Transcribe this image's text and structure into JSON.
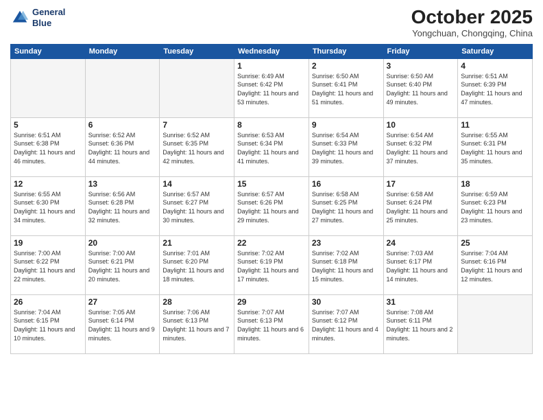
{
  "logo": {
    "line1": "General",
    "line2": "Blue"
  },
  "title": "October 2025",
  "location": "Yongchuan, Chongqing, China",
  "weekdays": [
    "Sunday",
    "Monday",
    "Tuesday",
    "Wednesday",
    "Thursday",
    "Friday",
    "Saturday"
  ],
  "weeks": [
    [
      {
        "day": "",
        "sunrise": "",
        "sunset": "",
        "daylight": ""
      },
      {
        "day": "",
        "sunrise": "",
        "sunset": "",
        "daylight": ""
      },
      {
        "day": "",
        "sunrise": "",
        "sunset": "",
        "daylight": ""
      },
      {
        "day": "1",
        "sunrise": "Sunrise: 6:49 AM",
        "sunset": "Sunset: 6:42 PM",
        "daylight": "Daylight: 11 hours and 53 minutes."
      },
      {
        "day": "2",
        "sunrise": "Sunrise: 6:50 AM",
        "sunset": "Sunset: 6:41 PM",
        "daylight": "Daylight: 11 hours and 51 minutes."
      },
      {
        "day": "3",
        "sunrise": "Sunrise: 6:50 AM",
        "sunset": "Sunset: 6:40 PM",
        "daylight": "Daylight: 11 hours and 49 minutes."
      },
      {
        "day": "4",
        "sunrise": "Sunrise: 6:51 AM",
        "sunset": "Sunset: 6:39 PM",
        "daylight": "Daylight: 11 hours and 47 minutes."
      }
    ],
    [
      {
        "day": "5",
        "sunrise": "Sunrise: 6:51 AM",
        "sunset": "Sunset: 6:38 PM",
        "daylight": "Daylight: 11 hours and 46 minutes."
      },
      {
        "day": "6",
        "sunrise": "Sunrise: 6:52 AM",
        "sunset": "Sunset: 6:36 PM",
        "daylight": "Daylight: 11 hours and 44 minutes."
      },
      {
        "day": "7",
        "sunrise": "Sunrise: 6:52 AM",
        "sunset": "Sunset: 6:35 PM",
        "daylight": "Daylight: 11 hours and 42 minutes."
      },
      {
        "day": "8",
        "sunrise": "Sunrise: 6:53 AM",
        "sunset": "Sunset: 6:34 PM",
        "daylight": "Daylight: 11 hours and 41 minutes."
      },
      {
        "day": "9",
        "sunrise": "Sunrise: 6:54 AM",
        "sunset": "Sunset: 6:33 PM",
        "daylight": "Daylight: 11 hours and 39 minutes."
      },
      {
        "day": "10",
        "sunrise": "Sunrise: 6:54 AM",
        "sunset": "Sunset: 6:32 PM",
        "daylight": "Daylight: 11 hours and 37 minutes."
      },
      {
        "day": "11",
        "sunrise": "Sunrise: 6:55 AM",
        "sunset": "Sunset: 6:31 PM",
        "daylight": "Daylight: 11 hours and 35 minutes."
      }
    ],
    [
      {
        "day": "12",
        "sunrise": "Sunrise: 6:55 AM",
        "sunset": "Sunset: 6:30 PM",
        "daylight": "Daylight: 11 hours and 34 minutes."
      },
      {
        "day": "13",
        "sunrise": "Sunrise: 6:56 AM",
        "sunset": "Sunset: 6:28 PM",
        "daylight": "Daylight: 11 hours and 32 minutes."
      },
      {
        "day": "14",
        "sunrise": "Sunrise: 6:57 AM",
        "sunset": "Sunset: 6:27 PM",
        "daylight": "Daylight: 11 hours and 30 minutes."
      },
      {
        "day": "15",
        "sunrise": "Sunrise: 6:57 AM",
        "sunset": "Sunset: 6:26 PM",
        "daylight": "Daylight: 11 hours and 29 minutes."
      },
      {
        "day": "16",
        "sunrise": "Sunrise: 6:58 AM",
        "sunset": "Sunset: 6:25 PM",
        "daylight": "Daylight: 11 hours and 27 minutes."
      },
      {
        "day": "17",
        "sunrise": "Sunrise: 6:58 AM",
        "sunset": "Sunset: 6:24 PM",
        "daylight": "Daylight: 11 hours and 25 minutes."
      },
      {
        "day": "18",
        "sunrise": "Sunrise: 6:59 AM",
        "sunset": "Sunset: 6:23 PM",
        "daylight": "Daylight: 11 hours and 23 minutes."
      }
    ],
    [
      {
        "day": "19",
        "sunrise": "Sunrise: 7:00 AM",
        "sunset": "Sunset: 6:22 PM",
        "daylight": "Daylight: 11 hours and 22 minutes."
      },
      {
        "day": "20",
        "sunrise": "Sunrise: 7:00 AM",
        "sunset": "Sunset: 6:21 PM",
        "daylight": "Daylight: 11 hours and 20 minutes."
      },
      {
        "day": "21",
        "sunrise": "Sunrise: 7:01 AM",
        "sunset": "Sunset: 6:20 PM",
        "daylight": "Daylight: 11 hours and 18 minutes."
      },
      {
        "day": "22",
        "sunrise": "Sunrise: 7:02 AM",
        "sunset": "Sunset: 6:19 PM",
        "daylight": "Daylight: 11 hours and 17 minutes."
      },
      {
        "day": "23",
        "sunrise": "Sunrise: 7:02 AM",
        "sunset": "Sunset: 6:18 PM",
        "daylight": "Daylight: 11 hours and 15 minutes."
      },
      {
        "day": "24",
        "sunrise": "Sunrise: 7:03 AM",
        "sunset": "Sunset: 6:17 PM",
        "daylight": "Daylight: 11 hours and 14 minutes."
      },
      {
        "day": "25",
        "sunrise": "Sunrise: 7:04 AM",
        "sunset": "Sunset: 6:16 PM",
        "daylight": "Daylight: 11 hours and 12 minutes."
      }
    ],
    [
      {
        "day": "26",
        "sunrise": "Sunrise: 7:04 AM",
        "sunset": "Sunset: 6:15 PM",
        "daylight": "Daylight: 11 hours and 10 minutes."
      },
      {
        "day": "27",
        "sunrise": "Sunrise: 7:05 AM",
        "sunset": "Sunset: 6:14 PM",
        "daylight": "Daylight: 11 hours and 9 minutes."
      },
      {
        "day": "28",
        "sunrise": "Sunrise: 7:06 AM",
        "sunset": "Sunset: 6:13 PM",
        "daylight": "Daylight: 11 hours and 7 minutes."
      },
      {
        "day": "29",
        "sunrise": "Sunrise: 7:07 AM",
        "sunset": "Sunset: 6:13 PM",
        "daylight": "Daylight: 11 hours and 6 minutes."
      },
      {
        "day": "30",
        "sunrise": "Sunrise: 7:07 AM",
        "sunset": "Sunset: 6:12 PM",
        "daylight": "Daylight: 11 hours and 4 minutes."
      },
      {
        "day": "31",
        "sunrise": "Sunrise: 7:08 AM",
        "sunset": "Sunset: 6:11 PM",
        "daylight": "Daylight: 11 hours and 2 minutes."
      },
      {
        "day": "",
        "sunrise": "",
        "sunset": "",
        "daylight": ""
      }
    ]
  ]
}
